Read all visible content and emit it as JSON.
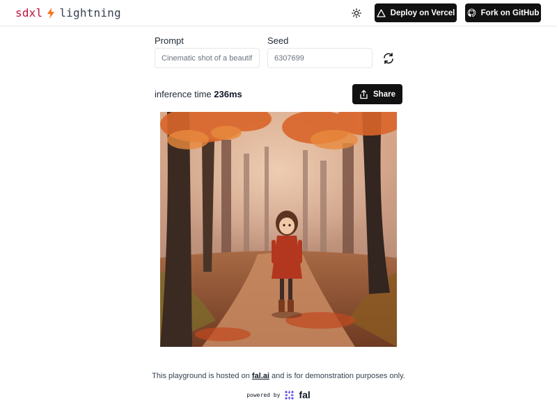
{
  "header": {
    "brand_left": "sdxl",
    "brand_right": "lightning",
    "deploy_label": "Deploy on Vercel",
    "github_label": "Fork on GitHub"
  },
  "form": {
    "prompt_label": "Prompt",
    "prompt_value": "Cinematic shot of a beautifu",
    "seed_label": "Seed",
    "seed_value": "6307699"
  },
  "result": {
    "inference_prefix": "inference time",
    "inference_value": "236ms",
    "share_label": "Share"
  },
  "footer": {
    "text_before": "This playground is hosted on",
    "link": "fal.ai",
    "text_after": "and is for demonstration purposes only.",
    "powered_by": "powered by",
    "logo_text": "fal"
  },
  "colors": {
    "accent_bolt": "#f97316",
    "button_dark": "#111111"
  },
  "icons": [
    "sun-icon",
    "triangle-icon",
    "github-icon",
    "refresh-icon",
    "share-icon",
    "bolt-icon",
    "fal-logo-icon"
  ]
}
